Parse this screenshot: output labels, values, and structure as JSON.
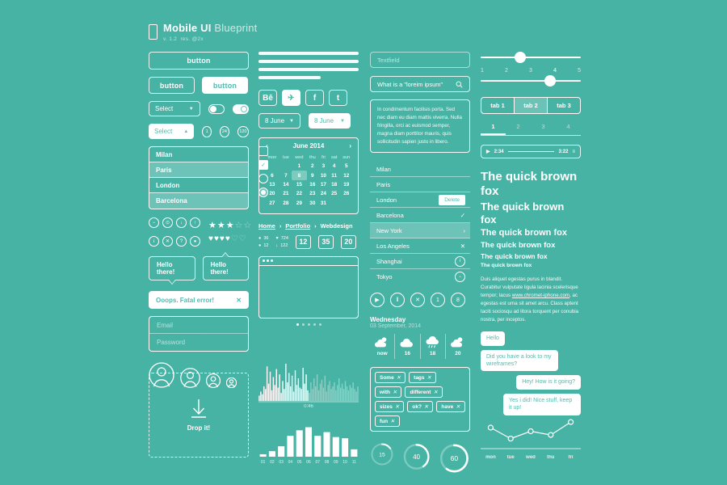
{
  "header": {
    "title_bold": "Mobile UI",
    "title_light": "Blueprint",
    "sub_v": "v. 1.2",
    "sub_res": "res. @2x",
    "icon": "phone-icon"
  },
  "col1": {
    "button_wide": "button",
    "button_outline": "button",
    "button_filled": "button",
    "select1": "Select",
    "select2": "Select",
    "caret_down": "▼",
    "caret_up": "▲",
    "badges": [
      "1",
      "24",
      "120"
    ],
    "list": [
      {
        "label": "Milan",
        "selected": false
      },
      {
        "label": "Paris",
        "selected": true
      },
      {
        "label": "London",
        "selected": false
      },
      {
        "label": "Barcelona",
        "selected": false
      }
    ],
    "check_marks": [
      "✓"
    ],
    "icon_row_1": [
      "−",
      "⊙",
      "↓",
      "↑"
    ],
    "icon_row_2": [
      "i",
      "✕",
      "?",
      "●"
    ],
    "stars_filled": 3,
    "stars_total": 5,
    "hearts_filled": 4,
    "hearts_total": 6,
    "tooltip_1": "Hello there!",
    "tooltip_2": "Hello there!",
    "alert_text": "Ooops. Fatal error!",
    "alert_close": "✕",
    "field_email": "Email",
    "field_password": "Password",
    "dropzone_label": "Drop it!",
    "dropzone_icon": "download-arrow-icon"
  },
  "col2": {
    "calendar": {
      "month": "June 2014",
      "prev": "‹",
      "next": "›",
      "weekdays": [
        "mon",
        "tue",
        "wed",
        "thu",
        "fri",
        "sat",
        "sun"
      ],
      "weeks": [
        [
          "",
          "",
          "1",
          "2",
          "3",
          "4",
          "5"
        ],
        [
          "6",
          "7",
          "8",
          "9",
          "10",
          "11",
          "12"
        ],
        [
          "13",
          "14",
          "15",
          "16",
          "17",
          "18",
          "19"
        ],
        [
          "20",
          "21",
          "22",
          "23",
          "24",
          "25",
          "26"
        ],
        [
          "27",
          "28",
          "29",
          "30",
          "31",
          "",
          ""
        ]
      ],
      "highlight_day": "8"
    },
    "social": [
      {
        "name": "behance-icon",
        "glyph": "Bē",
        "active": false
      },
      {
        "name": "twitter-icon",
        "glyph": "✈",
        "active": true
      },
      {
        "name": "facebook-icon",
        "glyph": "f",
        "active": false
      },
      {
        "name": "tumblr-icon",
        "glyph": "t",
        "active": false
      }
    ],
    "date_picker_1": "8 June",
    "date_picker_2": "8 June",
    "breadcrumb": [
      "Home",
      "Portfolio",
      "Webdesign"
    ],
    "breadcrumb_sep": "›",
    "stats": [
      {
        "icon": "comment-icon",
        "value": "36"
      },
      {
        "icon": "heart-icon",
        "value": "724"
      },
      {
        "icon": "pin-icon",
        "value": "12"
      },
      {
        "icon": "download-icon",
        "value": "122"
      }
    ],
    "number_boxes": [
      "12",
      "35",
      "20"
    ]
  },
  "col3": {
    "textfield_placeholder": "Textfield",
    "search_value": "What is a \"loreim ipsum\"",
    "search_icon": "search-icon",
    "paragraph": "In condimentum facilisis porta. Sed nec diam eu diam mattis viverra. Nulla fringilla, orci ac euismod semper, magna diam porttitor mauris, quis sollicitudin sapien justo in libero.",
    "city_list": [
      {
        "label": "Milan",
        "action": "",
        "action_name": "none",
        "selected": false
      },
      {
        "label": "Paris",
        "action": "",
        "action_name": "none",
        "selected": false
      },
      {
        "label": "London",
        "action": "Delete",
        "action_name": "delete-button",
        "selected": false
      },
      {
        "label": "Barcelona",
        "action": "✓",
        "action_name": "check-icon",
        "selected": false
      },
      {
        "label": "New York",
        "action": "›",
        "action_name": "chevron-right-icon",
        "selected": true
      },
      {
        "label": "Los Angeles",
        "action": "✕",
        "action_name": "close-icon",
        "selected": false
      },
      {
        "label": "Shanghai",
        "action": "i",
        "action_name": "info-icon",
        "selected": false
      },
      {
        "label": "Tokyo",
        "action": "−",
        "action_name": "minus-icon",
        "selected": false
      }
    ],
    "media_buttons": [
      {
        "glyph": "▶",
        "name": "play-button"
      },
      {
        "glyph": "‖",
        "name": "pause-button"
      },
      {
        "glyph": "✕",
        "name": "close-button"
      },
      {
        "glyph": "1",
        "name": "count-one-button"
      },
      {
        "glyph": "8",
        "name": "count-eight-button"
      }
    ],
    "weather_day": "Wednesday",
    "weather_date": "03 September, 2014",
    "weather": [
      {
        "label": "now",
        "icon": "sun-cloud-icon"
      },
      {
        "label": "16",
        "icon": "cloud-icon"
      },
      {
        "label": "18",
        "icon": "rain-icon"
      },
      {
        "label": "20",
        "icon": "sun-cloud-icon"
      }
    ],
    "tags": [
      "Some",
      "tags",
      "with",
      "different",
      "sizes",
      "ok?",
      "have",
      "fun"
    ],
    "tag_remove": "✕",
    "donuts": [
      {
        "value": 15,
        "label": "15"
      },
      {
        "value": 40,
        "label": "40"
      },
      {
        "value": 60,
        "label": "60"
      }
    ]
  },
  "col4": {
    "slider1_pct": 38,
    "slider2_pct": 72,
    "scale": [
      "1",
      "2",
      "3",
      "4",
      "5"
    ],
    "scale_active": "4",
    "tabs": [
      {
        "label": "tab 1",
        "active": false
      },
      {
        "label": "tab 2",
        "active": true
      },
      {
        "label": "tab 3",
        "active": false
      }
    ],
    "pagination": [
      {
        "label": "1",
        "active": true
      },
      {
        "label": "2",
        "active": false
      },
      {
        "label": "3",
        "active": false
      },
      {
        "label": "4",
        "active": false
      }
    ],
    "player": {
      "play_icon": "play-icon",
      "elapsed": "2:34",
      "total": "3:22",
      "menu_icon": "list-icon"
    },
    "type_samples": [
      {
        "text": "The quick brown fox",
        "size": 15
      },
      {
        "text": "The quick brown fox",
        "size": 13
      },
      {
        "text": "The quick brown fox",
        "size": 11
      },
      {
        "text": "The quick brown fox",
        "size": 9.5
      },
      {
        "text": "The quick brown fox",
        "size": 8.5
      },
      {
        "text": "The quick brown fox",
        "size": 6.5
      }
    ],
    "body_pre": "Duis aliquet egestas purus in blandit. Curabitur vulputate ligula lacinia scelerisque tempor; lacus ",
    "body_link": "www.chromet-iphone.com",
    "body_post": ", ac egestas est urna sit amet arcu. Class aptent taciti sociosqu ad litora torquent per conubia nostra, per inceptos.",
    "chat": [
      {
        "text": "Hello",
        "side": "left"
      },
      {
        "text": "Did you have a look to my wireframes?",
        "side": "left"
      },
      {
        "text": "Hey! How is it going?",
        "side": "right"
      },
      {
        "text": "Yes i did! Nice stuff, keep it up!",
        "side": "right"
      }
    ]
  },
  "charts": {
    "waveform": {
      "type": "bar",
      "title": "",
      "time_label": "0:46",
      "values": [
        4,
        7,
        5,
        11,
        9,
        26,
        13,
        22,
        8,
        18,
        12,
        24,
        10,
        20,
        6,
        15,
        9,
        28,
        14,
        21,
        11,
        19,
        7,
        23,
        12,
        17,
        10,
        9,
        25,
        13,
        20,
        8,
        6,
        14,
        9,
        17,
        11,
        20,
        8,
        13,
        16,
        10,
        19,
        7,
        12,
        15,
        9,
        11,
        14,
        8,
        12,
        17,
        10,
        13,
        9,
        15,
        11,
        8,
        12,
        10,
        14,
        9,
        7,
        11
      ]
    },
    "bar_chart": {
      "type": "bar",
      "categories": [
        "01",
        "02",
        "03",
        "04",
        "05",
        "06",
        "07",
        "08",
        "09",
        "10",
        "11"
      ],
      "values": [
        4,
        9,
        17,
        34,
        43,
        48,
        34,
        40,
        32,
        30,
        12
      ],
      "ylim": [
        0,
        50
      ],
      "xlabel": "",
      "ylabel": ""
    },
    "line_chart": {
      "type": "line",
      "categories": [
        "mon",
        "tue",
        "wed",
        "thu",
        "fri"
      ],
      "values": [
        58,
        22,
        46,
        34,
        76
      ],
      "ylim": [
        0,
        100
      ],
      "xlabel": "",
      "ylabel": ""
    },
    "donut_chart": {
      "type": "pie",
      "categories": [
        "15",
        "40",
        "60"
      ],
      "values": [
        15,
        40,
        60
      ]
    }
  },
  "colors": {
    "background": "#46b3a4",
    "foreground": "#ffffff",
    "accent_fill": "#4fbcae"
  }
}
